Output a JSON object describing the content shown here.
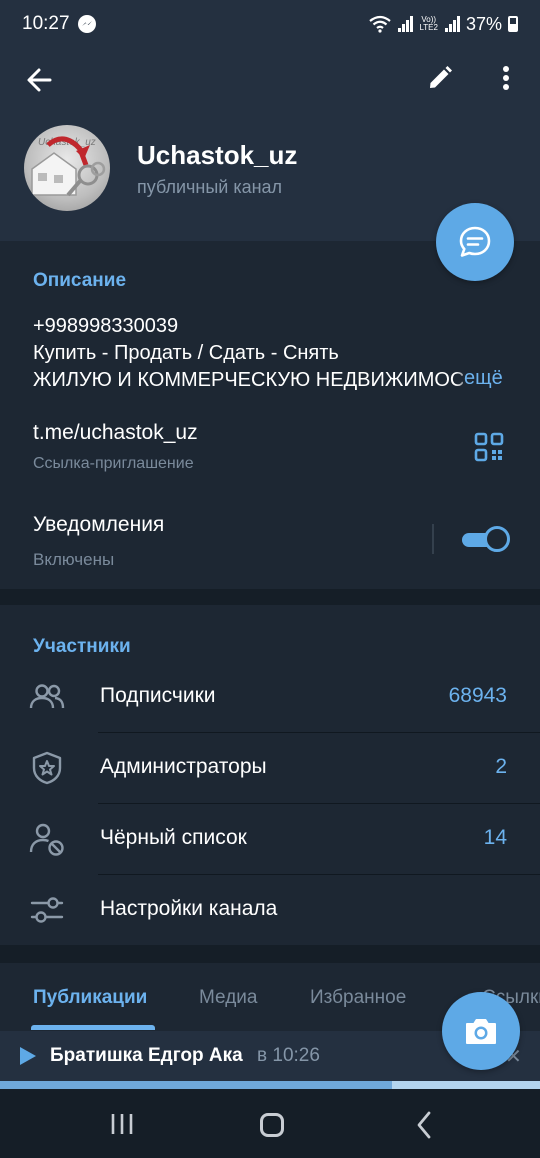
{
  "status_bar": {
    "time": "10:27",
    "lte_top": "Vo))",
    "lte_bottom": "LTE2",
    "battery": "37%"
  },
  "header": {
    "channel_name": "Uchastok_uz",
    "channel_type": "публичный канал",
    "icons": [
      "back-arrow-icon",
      "pencil-icon",
      "more-vertical-icon",
      "chat-bubble-icon"
    ]
  },
  "info": {
    "section_title": "Описание",
    "description_lines": [
      "+998998330039",
      "Купить - Продать / Сдать - Снять",
      "ЖИЛУЮ И КОММЕРЧЕСКУЮ   НЕДВИЖИМОСТЬ"
    ],
    "more_label": "ещё",
    "link": "t.me/uchastok_uz",
    "link_caption": "Ссылка-приглашение",
    "notifications_label": "Уведомления",
    "notifications_status": "Включены",
    "notifications_on": true
  },
  "members": {
    "section_title": "Участники",
    "rows": [
      {
        "label": "Подписчики",
        "count": "68943",
        "icon": "users-icon"
      },
      {
        "label": "Администраторы",
        "count": "2",
        "icon": "shield-star-icon"
      },
      {
        "label": "Чёрный список",
        "count": "14",
        "icon": "user-blocked-icon"
      },
      {
        "label": "Настройки канала",
        "count": "",
        "icon": "sliders-icon"
      }
    ]
  },
  "tabs": {
    "items": [
      "Публикации",
      "Медиа",
      "Избранное",
      "Ссылки"
    ],
    "active_index": 0
  },
  "player": {
    "title": "Братишка Едгор Ака",
    "time": "в 10:26",
    "progress": 0.726
  },
  "colors": {
    "accent": "#6cb2ee",
    "fab": "#5ea9e6",
    "background": "#1d2733",
    "header": "#243040"
  }
}
